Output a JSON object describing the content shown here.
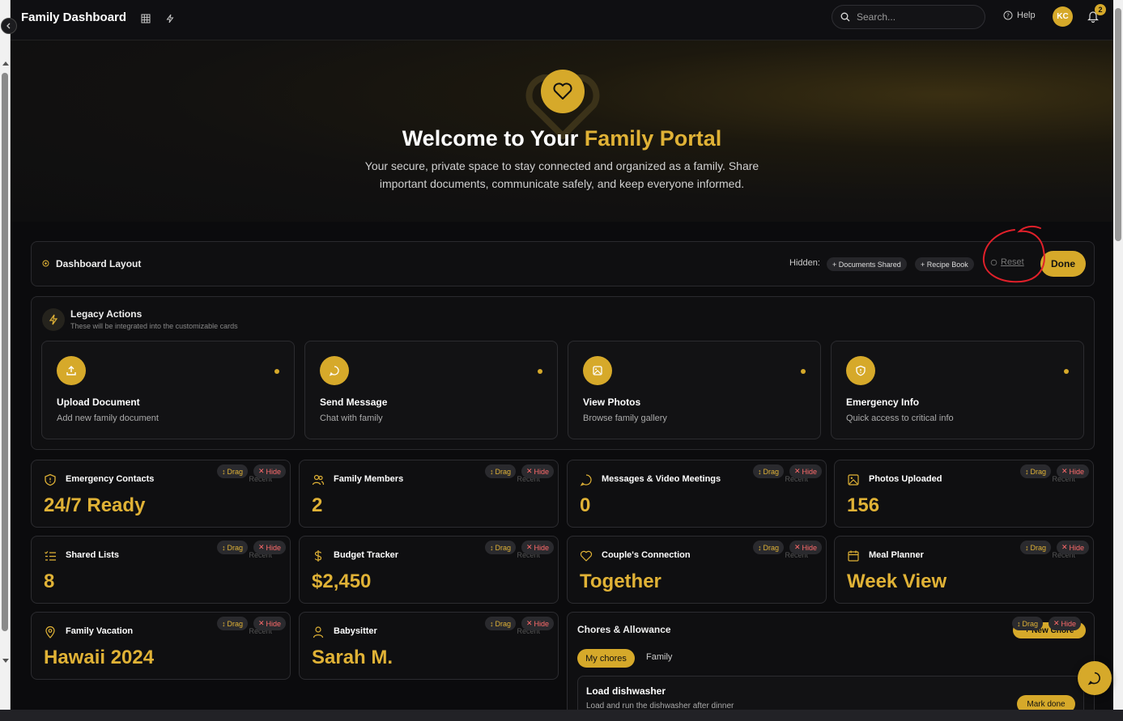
{
  "app": {
    "title": "Family Dashboard"
  },
  "topbar": {
    "search_placeholder": "Search...",
    "help_label": "Help",
    "avatar_initials": "KC",
    "notification_count": "2"
  },
  "hero": {
    "title_prefix": "Welcome to Your ",
    "title_highlight": "Family Portal",
    "subtitle": "Your secure, private space to stay connected and organized as a family. Share important documents, communicate safely, and keep everyone informed."
  },
  "layout_bar": {
    "label": "Dashboard Layout",
    "hidden_label": "Hidden:",
    "hidden_chips": [
      "+ Documents Shared",
      "+ Recipe Book"
    ],
    "reset_label": "Reset",
    "done_label": "Done"
  },
  "legacy": {
    "title": "Legacy Actions",
    "subtitle": "These will be integrated into the customizable cards",
    "actions": [
      {
        "title": "Upload Document",
        "subtitle": "Add new family document",
        "icon": "upload-icon"
      },
      {
        "title": "Send Message",
        "subtitle": "Chat with family",
        "icon": "message-icon"
      },
      {
        "title": "View Photos",
        "subtitle": "Browse family gallery",
        "icon": "image-icon"
      },
      {
        "title": "Emergency Info",
        "subtitle": "Quick access to critical info",
        "icon": "shield-icon"
      }
    ]
  },
  "card_controls": {
    "drag_label": "Drag",
    "hide_label": "Hide",
    "recent_label": "Recent"
  },
  "cards": [
    {
      "title": "Emergency Contacts",
      "value": "24/7 Ready",
      "icon": "shield-icon"
    },
    {
      "title": "Family Members",
      "value": "2",
      "icon": "users-icon"
    },
    {
      "title": "Messages & Video Meetings",
      "value": "0",
      "icon": "message-icon"
    },
    {
      "title": "Photos Uploaded",
      "value": "156",
      "icon": "image-icon"
    },
    {
      "title": "Shared Lists",
      "value": "8",
      "icon": "list-icon"
    },
    {
      "title": "Budget Tracker",
      "value": "$2,450",
      "icon": "dollar-icon"
    },
    {
      "title": "Couple's Connection",
      "value": "Together",
      "icon": "heart-icon"
    },
    {
      "title": "Meal Planner",
      "value": "Week View",
      "icon": "calendar-icon"
    },
    {
      "title": "Family Vacation",
      "value": "Hawaii 2024",
      "icon": "map-pin-icon"
    },
    {
      "title": "Babysitter",
      "value": "Sarah M.",
      "icon": "user-icon"
    }
  ],
  "chores": {
    "title": "Chores & Allowance",
    "new_chore_label": "+ New Chore",
    "tabs": [
      "My chores",
      "Family"
    ],
    "items": [
      {
        "name": "Load dishwasher",
        "description": "Load and run the dishwasher after dinner",
        "action": "Mark done"
      }
    ]
  },
  "colors": {
    "accent": "#d6a92a",
    "background": "#0b0b0d",
    "hide_red": "#ff6b6b"
  }
}
